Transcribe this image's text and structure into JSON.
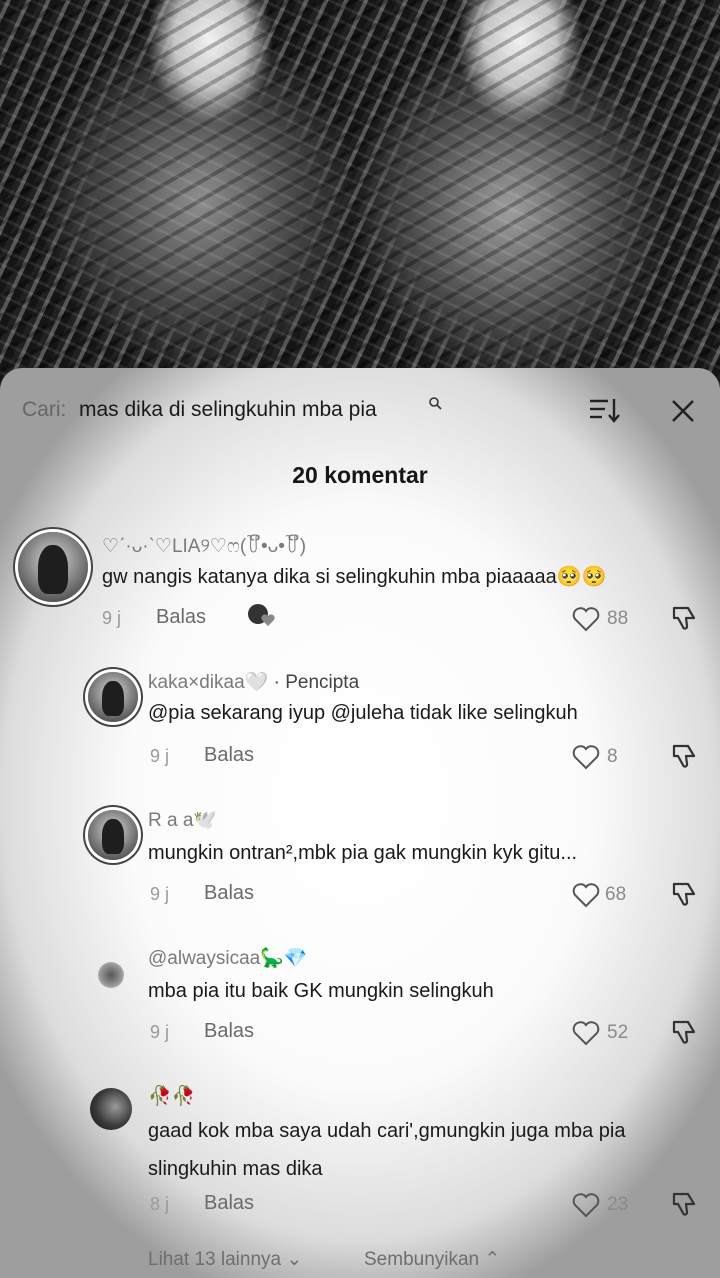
{
  "search": {
    "label": "Cari:",
    "query": "mas dika di selingkuhin mba pia"
  },
  "comment_count_title": "20 komentar",
  "comments": [
    {
      "username": "♡ˊ·ᴗ·ˋ♡LIA୨♡ෆ(꒦ິ•ᴗ•꒦ິ)",
      "text": "gw nangis katanya dika si selingkuhin mba piaaaaa🥺🥺",
      "time": "9 j",
      "reply": "Balas",
      "likes": "88"
    },
    {
      "username": "kaka×dikaa🤍",
      "creator_label": "· Pencipta",
      "text": "@pia sekarang iyup @juleha tidak like selingkuh",
      "time": "9 j",
      "reply": "Balas",
      "likes": "8"
    },
    {
      "username": "R a a🕊️",
      "text": "mungkin ontran²,mbk pia gak mungkin kyk gitu...",
      "time": "9 j",
      "reply": "Balas",
      "likes": "68"
    },
    {
      "username": "@alwaysicaa🦕💎",
      "text": "mba pia itu baik GK mungkin selingkuh",
      "time": "9 j",
      "reply": "Balas",
      "likes": "52"
    },
    {
      "username": "🥀🥀",
      "text_line1": "gaad kok mba saya udah cari',gmungkin juga mba pia",
      "text_line2": "slingkuhin mas dika",
      "time": "8 j",
      "reply": "Balas",
      "likes": "23"
    }
  ],
  "footer": {
    "more": "Lihat 13 lainnya ⌄",
    "hide": "Sembunyikan ⌃"
  },
  "icons": [
    "search-icon",
    "sort-icon",
    "close-icon",
    "heart-icon",
    "dislike-icon"
  ]
}
